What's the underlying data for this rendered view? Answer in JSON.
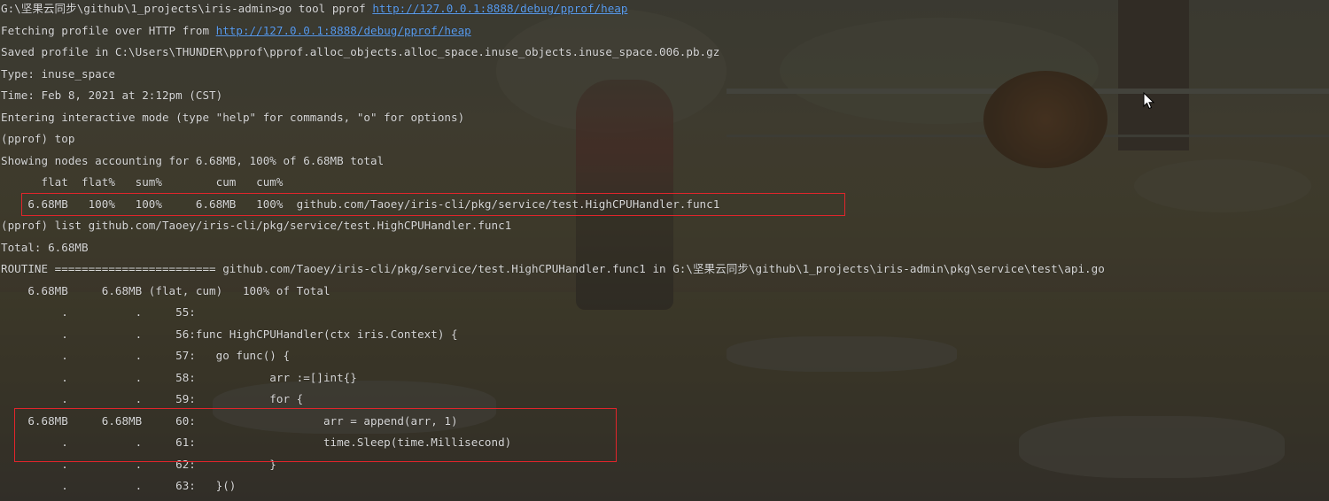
{
  "terminal": {
    "lines": [
      {
        "prefix": "G:\\坚果云同步\\github\\1_projects\\iris-admin>go tool pprof ",
        "link": "http://127.0.0.1:8888/debug/pprof/heap"
      },
      {
        "prefix": "Fetching profile over HTTP from ",
        "link": "http://127.0.0.1:8888/debug/pprof/heap"
      },
      {
        "text": "Saved profile in C:\\Users\\THUNDER\\pprof\\pprof.alloc_objects.alloc_space.inuse_objects.inuse_space.006.pb.gz"
      },
      {
        "text": "Type: inuse_space"
      },
      {
        "text": "Time: Feb 8, 2021 at 2:12pm (CST)"
      },
      {
        "text": "Entering interactive mode (type \"help\" for commands, \"o\" for options)"
      },
      {
        "text": "(pprof) top"
      },
      {
        "text": "Showing nodes accounting for 6.68MB, 100% of 6.68MB total"
      },
      {
        "text": "      flat  flat%   sum%        cum   cum%"
      },
      {
        "text": "    6.68MB   100%   100%     6.68MB   100%  github.com/Taoey/iris-cli/pkg/service/test.HighCPUHandler.func1"
      },
      {
        "text": "(pprof) list github.com/Taoey/iris-cli/pkg/service/test.HighCPUHandler.func1"
      },
      {
        "text": "Total: 6.68MB"
      },
      {
        "text": "ROUTINE ======================== github.com/Taoey/iris-cli/pkg/service/test.HighCPUHandler.func1 in G:\\坚果云同步\\github\\1_projects\\iris-admin\\pkg\\service\\test\\api.go"
      },
      {
        "text": "    6.68MB     6.68MB (flat, cum)   100% of Total"
      },
      {
        "text": "         .          .     55:"
      },
      {
        "text": "         .          .     56:func HighCPUHandler(ctx iris.Context) {"
      },
      {
        "text": "         .          .     57:   go func() {"
      },
      {
        "text": "         .          .     58:           arr :=[]int{}"
      },
      {
        "text": "         .          .     59:           for {"
      },
      {
        "text": "    6.68MB     6.68MB     60:                   arr = append(arr, 1)"
      },
      {
        "text": "         .          .     61:                   time.Sleep(time.Millisecond)"
      },
      {
        "text": "         .          .     62:           }"
      },
      {
        "text": "         .          .     63:   }()"
      }
    ]
  },
  "colors": {
    "text": "#d8d8d8",
    "link": "#5b9ef0",
    "highlight_box": "#e0252b"
  },
  "icons": {
    "mouse_cursor": "arrow-cursor-icon"
  }
}
